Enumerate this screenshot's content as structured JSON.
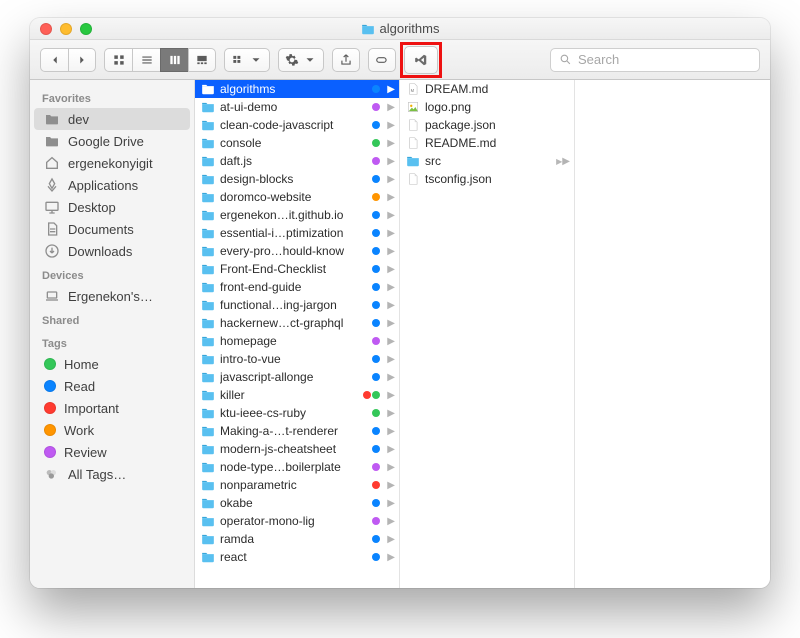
{
  "window": {
    "title": "algorithms"
  },
  "toolbar": {
    "search_placeholder": "Search"
  },
  "sidebar": {
    "sections": {
      "favorites": "Favorites",
      "devices": "Devices",
      "shared": "Shared",
      "tags": "Tags"
    },
    "favorites": [
      {
        "label": "dev",
        "icon": "folder",
        "selected": true
      },
      {
        "label": "Google Drive",
        "icon": "folder"
      },
      {
        "label": "ergenekonyigit",
        "icon": "home"
      },
      {
        "label": "Applications",
        "icon": "apps"
      },
      {
        "label": "Desktop",
        "icon": "desktop"
      },
      {
        "label": "Documents",
        "icon": "doc"
      },
      {
        "label": "Downloads",
        "icon": "downloads"
      }
    ],
    "devices": [
      {
        "label": "Ergenekon's…",
        "icon": "laptop"
      }
    ],
    "tags": [
      {
        "label": "Home",
        "color": "#34c759"
      },
      {
        "label": "Read",
        "color": "#0a84ff"
      },
      {
        "label": "Important",
        "color": "#ff3b30"
      },
      {
        "label": "Work",
        "color": "#ff9500"
      },
      {
        "label": "Review",
        "color": "#bf5af2"
      },
      {
        "label": "All Tags…",
        "color": null,
        "all": true
      }
    ]
  },
  "col1": [
    {
      "name": "algorithms",
      "tags": [
        "#0a84ff"
      ],
      "selected": true
    },
    {
      "name": "at-ui-demo",
      "tags": [
        "#bf5af2"
      ]
    },
    {
      "name": "clean-code-javascript",
      "tags": [
        "#0a84ff"
      ]
    },
    {
      "name": "console",
      "tags": [
        "#34c759"
      ]
    },
    {
      "name": "daft.js",
      "tags": [
        "#bf5af2"
      ]
    },
    {
      "name": "design-blocks",
      "tags": [
        "#0a84ff"
      ]
    },
    {
      "name": "doromco-website",
      "tags": [
        "#ff9500"
      ]
    },
    {
      "name": "ergenekon…it.github.io",
      "tags": [
        "#0a84ff"
      ]
    },
    {
      "name": "essential-i…ptimization",
      "tags": [
        "#0a84ff"
      ]
    },
    {
      "name": "every-pro…hould-know",
      "tags": [
        "#0a84ff"
      ]
    },
    {
      "name": "Front-End-Checklist",
      "tags": [
        "#0a84ff"
      ]
    },
    {
      "name": "front-end-guide",
      "tags": [
        "#0a84ff"
      ]
    },
    {
      "name": "functional…ing-jargon",
      "tags": [
        "#0a84ff"
      ]
    },
    {
      "name": "hackernew…ct-graphql",
      "tags": [
        "#0a84ff"
      ]
    },
    {
      "name": "homepage",
      "tags": [
        "#bf5af2"
      ]
    },
    {
      "name": "intro-to-vue",
      "tags": [
        "#0a84ff"
      ]
    },
    {
      "name": "javascript-allonge",
      "tags": [
        "#0a84ff"
      ]
    },
    {
      "name": "killer",
      "tags": [
        "#ff3b30",
        "#34c759"
      ]
    },
    {
      "name": "ktu-ieee-cs-ruby",
      "tags": [
        "#34c759"
      ]
    },
    {
      "name": "Making-a-…t-renderer",
      "tags": [
        "#0a84ff"
      ]
    },
    {
      "name": "modern-js-cheatsheet",
      "tags": [
        "#0a84ff"
      ]
    },
    {
      "name": "node-type…boilerplate",
      "tags": [
        "#bf5af2"
      ]
    },
    {
      "name": "nonparametric",
      "tags": [
        "#ff3b30"
      ]
    },
    {
      "name": "okabe",
      "tags": [
        "#0a84ff"
      ]
    },
    {
      "name": "operator-mono-lig",
      "tags": [
        "#bf5af2"
      ]
    },
    {
      "name": "ramda",
      "tags": [
        "#0a84ff"
      ]
    },
    {
      "name": "react",
      "tags": [
        "#0a84ff"
      ]
    }
  ],
  "col2": [
    {
      "name": "DREAM.md",
      "type": "file",
      "icon": "md"
    },
    {
      "name": "logo.png",
      "type": "file",
      "icon": "image"
    },
    {
      "name": "package.json",
      "type": "file",
      "icon": "doc"
    },
    {
      "name": "README.md",
      "type": "file",
      "icon": "doc"
    },
    {
      "name": "src",
      "type": "folder"
    },
    {
      "name": "tsconfig.json",
      "type": "file",
      "icon": "doc"
    }
  ]
}
